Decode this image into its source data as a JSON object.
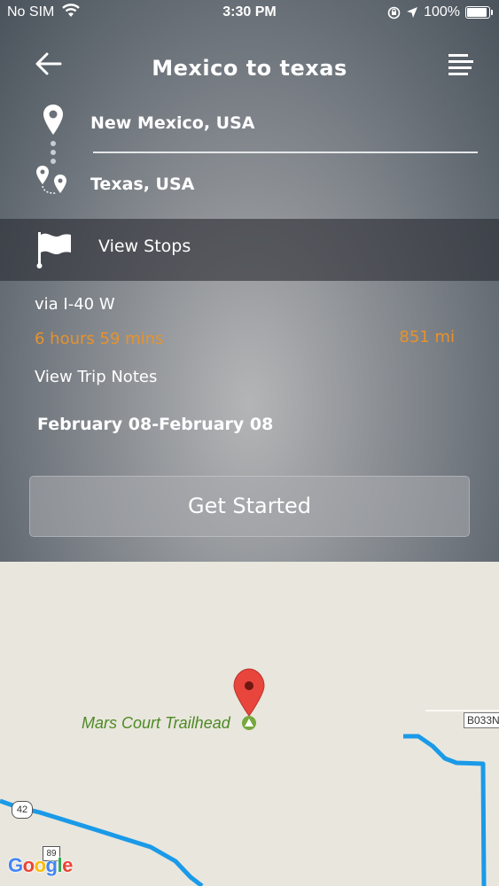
{
  "status_bar": {
    "carrier": "No SIM",
    "time": "3:30 PM",
    "battery_text": "100%",
    "battery_level": 1.0
  },
  "header": {
    "title": "Mexico to texas",
    "back_icon": "arrow-left-icon",
    "menu_icon": "menu-lines-icon"
  },
  "route": {
    "origin": "New Mexico, USA",
    "destination": "Texas, USA",
    "origin_icon": "map-pin-icon",
    "destination_icon": "route-pins-icon"
  },
  "stops": {
    "label": "View Stops",
    "icon": "flag-icon"
  },
  "trip": {
    "via": "via I-40 W",
    "duration": "6 hours 59 mins",
    "distance": "851 mi",
    "notes_label": "View Trip Notes",
    "dates": "February 08-February 08"
  },
  "actions": {
    "start_label": "Get Started"
  },
  "map": {
    "poi_name": "Mars Court Trailhead",
    "road_label": "B033N",
    "shield_42": "42",
    "shield_89": "89",
    "attribution": "Google"
  },
  "colors": {
    "accent_orange": "#e8922a",
    "route_blue": "#1a9ae8",
    "poi_green": "#4d8a25",
    "marker_red": "#e8453c"
  }
}
